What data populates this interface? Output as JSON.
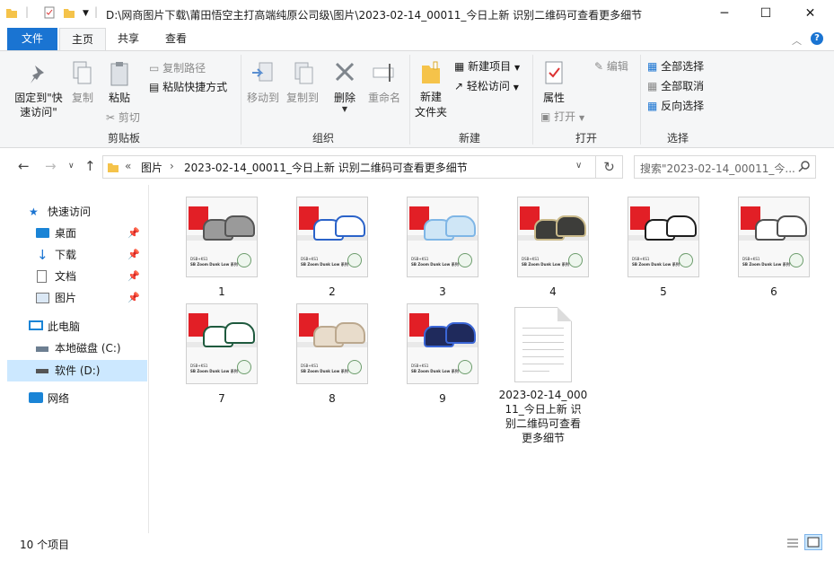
{
  "window": {
    "title": "D:\\网商图片下载\\莆田悟空主打高端纯原公司级\\图片\\2023-02-14_00011_今日上新 识别二维码可查看更多细节",
    "minimize": "─",
    "maximize": "☐",
    "close": "✕"
  },
  "ribbon_tabs": {
    "file": "文件",
    "home": "主页",
    "share": "共享",
    "view": "查看"
  },
  "ribbon": {
    "pin_quick": "固定到\"快\n速访问\"",
    "copy": "复制",
    "paste": "粘贴",
    "copy_path": "复制路径",
    "paste_shortcut": "粘贴快捷方式",
    "cut": "剪切",
    "group_clipboard": "剪贴板",
    "move_to": "移动到",
    "copy_to": "复制到",
    "delete": "删除",
    "rename": "重命名",
    "group_organize": "组织",
    "new_folder": "新建\n文件夹",
    "new_item": "新建项目",
    "easy_access": "轻松访问",
    "group_new": "新建",
    "properties": "属性",
    "open": "打开",
    "edit": "编辑",
    "group_open": "打开",
    "select_all": "全部选择",
    "select_none": "全部取消",
    "invert_selection": "反向选择",
    "group_select": "选择"
  },
  "address": {
    "prefix": "«",
    "crumb_1": "图片",
    "sep": "›",
    "crumb_2": "2023-02-14_00011_今日上新 识别二维码可查看更多细节",
    "search_placeholder": "搜索\"2023-02-14_00011_今..."
  },
  "nav": {
    "quick_access": "快速访问",
    "desktop": "桌面",
    "downloads": "下载",
    "documents": "文档",
    "pictures": "图片",
    "this_pc": "此电脑",
    "local_c": "本地磁盘 (C:)",
    "soft_d": "软件 (D:)",
    "network": "网络"
  },
  "files": [
    {
      "name": "1",
      "shoe": "#9a9a9a",
      "accent": "#555555"
    },
    {
      "name": "2",
      "shoe": "#ffffff",
      "accent": "#2b63c9"
    },
    {
      "name": "3",
      "shoe": "#cfe6f6",
      "accent": "#7fb6e6"
    },
    {
      "name": "4",
      "shoe": "#3d3d3a",
      "accent": "#c9b98a"
    },
    {
      "name": "5",
      "shoe": "#ffffff",
      "accent": "#1e1e1e"
    },
    {
      "name": "6",
      "shoe": "#ffffff",
      "accent": "#505050"
    },
    {
      "name": "7",
      "shoe": "#ffffff",
      "accent": "#1f5a3e"
    },
    {
      "name": "8",
      "shoe": "#e8dccb",
      "accent": "#bba88e"
    },
    {
      "name": "9",
      "shoe": "#1f2a5c",
      "accent": "#3b66d6"
    }
  ],
  "thumb_caption_1": "DSB+KS1",
  "thumb_caption_2": "SB Zoom Dunk Low 系列",
  "text_file": {
    "name": "2023-02-14_000\n11_今日上新 识\n别二维码可查看\n更多细节"
  },
  "status": {
    "count": "10 个项目"
  }
}
